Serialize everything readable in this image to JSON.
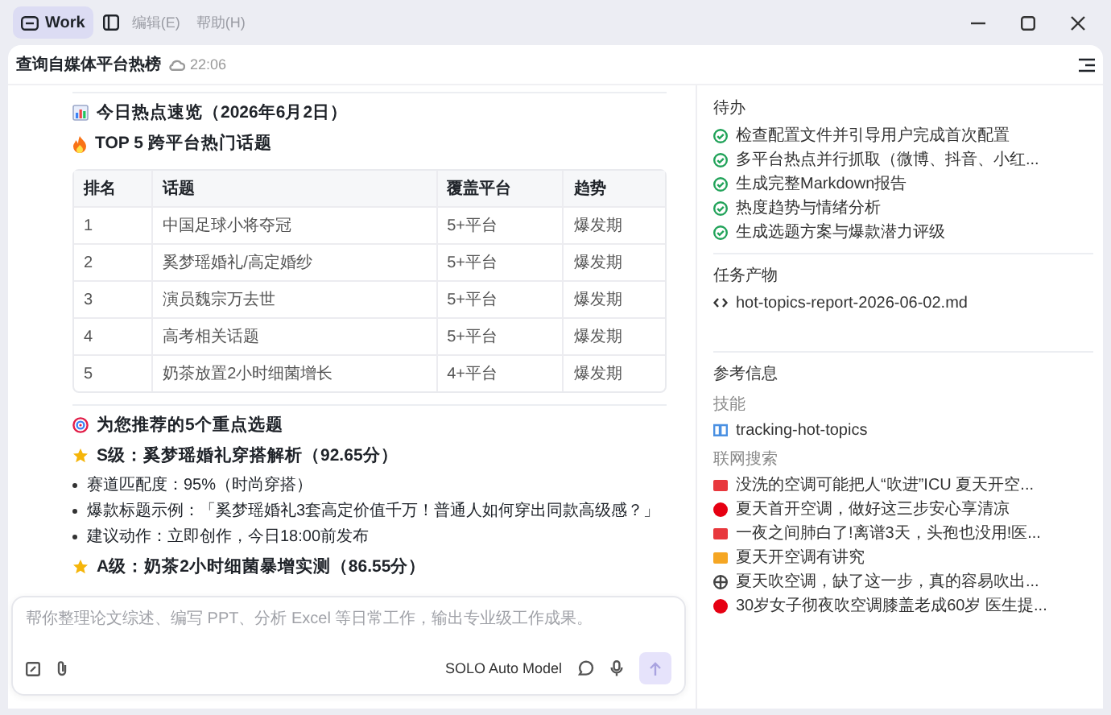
{
  "titlebar": {
    "tab": {
      "label": "Work",
      "selected": true
    },
    "menus": [
      "编辑(E)",
      "帮助(H)"
    ]
  },
  "header": {
    "title": "查询自媒体平台热榜",
    "time": "22:06"
  },
  "document": {
    "heading": "今日热点速览（2026年6月2日）",
    "subheading": "TOP 5 跨平台热门话题",
    "table": {
      "columns": [
        "排名",
        "话题",
        "覆盖平台",
        "趋势"
      ],
      "rows": [
        [
          "1",
          "中国足球小将夺冠",
          "5+平台",
          "爆发期"
        ],
        [
          "2",
          "奚梦瑶婚礼/高定婚纱",
          "5+平台",
          "爆发期"
        ],
        [
          "3",
          "演员魏宗万去世",
          "5+平台",
          "爆发期"
        ],
        [
          "4",
          "高考相关话题",
          "5+平台",
          "爆发期"
        ],
        [
          "5",
          "奶茶放置2小时细菌增长",
          "4+平台",
          "爆发期"
        ]
      ]
    },
    "recommend_heading": "为您推荐的5个重点选题",
    "picks": [
      {
        "title": "S级：奚梦瑶婚礼穿搭解析（92.65分）",
        "bullets": [
          "赛道匹配度：95%（时尚穿搭）",
          "爆款标题示例：「奚梦瑶婚礼3套高定价值千万！普通人如何穿出同款高级感？」",
          "建议动作：立即创作，今日18:00前发布"
        ]
      },
      {
        "title": "A级：奶茶2小时细菌暴增实测（86.55分）"
      }
    ]
  },
  "composer": {
    "placeholder": "帮你整理论文综述、编写 PPT、分析 Excel 等日常工作，输出专业级工作成果。",
    "model": "SOLO Auto Model",
    "send_disabled": true
  },
  "side": {
    "todo_title": "待办",
    "todos": [
      {
        "label": "检查配置文件并引导用户完成首次配置",
        "done": true
      },
      {
        "label": "多平台热点并行抓取（微博、抖音、小红...",
        "done": true
      },
      {
        "label": "生成完整Markdown报告",
        "done": true
      },
      {
        "label": "热度趋势与情绪分析",
        "done": true
      },
      {
        "label": "生成选题方案与爆款潜力评级",
        "done": true
      }
    ],
    "artifacts_title": "任务产物",
    "artifacts": [
      "hot-topics-report-2026-06-02.md"
    ],
    "refs_title": "参考信息",
    "skills_title": "技能",
    "skills": [
      "tracking-hot-topics"
    ],
    "search_title": "联网搜索",
    "results": [
      {
        "label": "没洗的空调可能把人“吹进”ICU 夏天开空...",
        "color": "#e8383d",
        "kind": "square"
      },
      {
        "label": "夏天首开空调，做好这三步安心享清凉",
        "color": "#e60012",
        "kind": "circle"
      },
      {
        "label": "一夜之间肺白了!离谱3天，头孢也没用!医...",
        "color": "#e8383d",
        "kind": "square"
      },
      {
        "label": "夏天开空调有讲究",
        "color": "#f5a623",
        "kind": "square"
      },
      {
        "label": "夏天吹空调，缺了这一步，真的容易吹出...",
        "color": "#444444",
        "kind": "globe"
      },
      {
        "label": "30岁女子彻夜吹空调膝盖老成60岁 医生提...",
        "color": "#e60012",
        "kind": "circle"
      }
    ]
  }
}
